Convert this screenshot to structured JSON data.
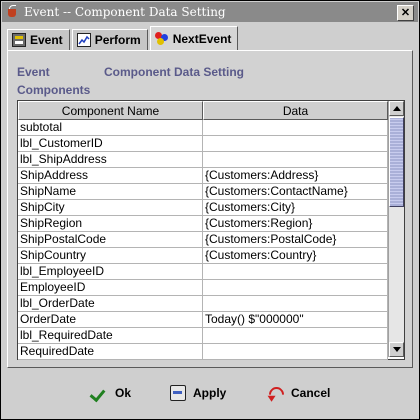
{
  "window": {
    "title": "Event -- Component Data Setting"
  },
  "tabs": [
    {
      "label": "Event",
      "icon": "event-icon"
    },
    {
      "label": "Perform",
      "icon": "perform-icon"
    },
    {
      "label": "NextEvent",
      "icon": "next-event-icon"
    }
  ],
  "header": {
    "event_label": "Event",
    "setting_label": "Component Data Setting",
    "components_label": "Components"
  },
  "table": {
    "columns": [
      "Component Name",
      "Data"
    ],
    "rows": [
      [
        "subtotal",
        ""
      ],
      [
        "lbl_CustomerID",
        ""
      ],
      [
        "lbl_ShipAddress",
        ""
      ],
      [
        "ShipAddress",
        "{Customers:Address}"
      ],
      [
        "ShipName",
        "{Customers:ContactName}"
      ],
      [
        "ShipCity",
        "{Customers:City}"
      ],
      [
        "ShipRegion",
        "{Customers:Region}"
      ],
      [
        "ShipPostalCode",
        "{Customers:PostalCode}"
      ],
      [
        "ShipCountry",
        "{Customers:Country}"
      ],
      [
        "lbl_EmployeeID",
        ""
      ],
      [
        "EmployeeID",
        ""
      ],
      [
        "lbl_OrderDate",
        ""
      ],
      [
        "OrderDate",
        " Today() $\"000000\""
      ],
      [
        "lbl_RequiredDate",
        ""
      ],
      [
        "RequiredDate",
        ""
      ]
    ]
  },
  "buttons": {
    "ok": "Ok",
    "apply": "Apply",
    "cancel": "Cancel"
  },
  "colors": {
    "label_text": "#5a5a8a",
    "scroll_thumb": "#aab0d8"
  }
}
